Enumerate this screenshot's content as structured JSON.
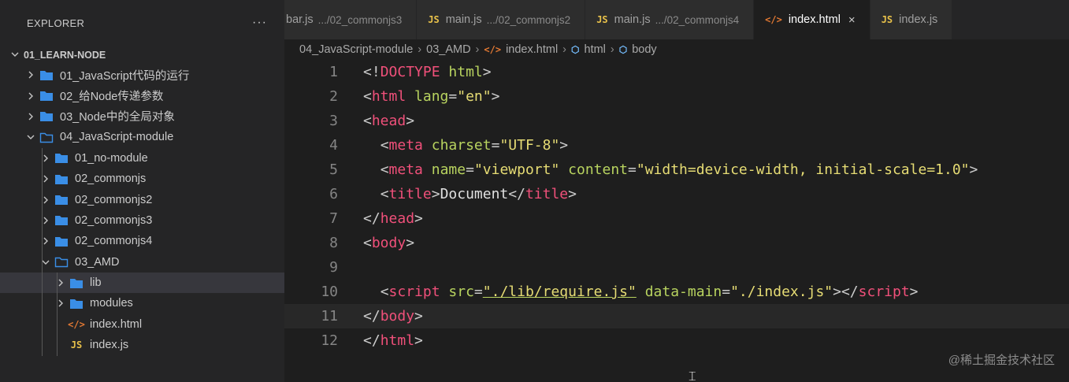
{
  "explorer": {
    "title": "EXPLORER",
    "more": "···",
    "workspace": "01_LEARN-NODE",
    "items": [
      {
        "label": "01_JavaScript代码的运行",
        "type": "folder",
        "depth": 0,
        "open": false
      },
      {
        "label": "02_给Node传递参数",
        "type": "folder",
        "depth": 0,
        "open": false
      },
      {
        "label": "03_Node中的全局对象",
        "type": "folder",
        "depth": 0,
        "open": false
      },
      {
        "label": "04_JavaScript-module",
        "type": "folder",
        "depth": 0,
        "open": true
      },
      {
        "label": "01_no-module",
        "type": "folder",
        "depth": 1,
        "open": false
      },
      {
        "label": "02_commonjs",
        "type": "folder",
        "depth": 1,
        "open": false
      },
      {
        "label": "02_commonjs2",
        "type": "folder",
        "depth": 1,
        "open": false
      },
      {
        "label": "02_commonjs3",
        "type": "folder",
        "depth": 1,
        "open": false
      },
      {
        "label": "02_commonjs4",
        "type": "folder",
        "depth": 1,
        "open": false
      },
      {
        "label": "03_AMD",
        "type": "folder",
        "depth": 1,
        "open": true
      },
      {
        "label": "lib",
        "type": "folder",
        "depth": 2,
        "open": false,
        "active": true
      },
      {
        "label": "modules",
        "type": "folder",
        "depth": 2,
        "open": false
      },
      {
        "label": "index.html",
        "type": "html",
        "depth": 2
      },
      {
        "label": "index.js",
        "type": "js",
        "depth": 2
      }
    ]
  },
  "icons": {
    "js": "JS",
    "html": "</>",
    "close": "×"
  },
  "tabs": [
    {
      "label": "bar.js",
      "desc": ".../02_commonjs3",
      "icon": "none",
      "active": false
    },
    {
      "label": "main.js",
      "desc": ".../02_commonjs2",
      "icon": "js",
      "active": false
    },
    {
      "label": "main.js",
      "desc": ".../02_commonjs4",
      "icon": "js",
      "active": false
    },
    {
      "label": "index.html",
      "desc": "",
      "icon": "html",
      "active": true
    },
    {
      "label": "index.js",
      "desc": "",
      "icon": "js",
      "active": false
    }
  ],
  "breadcrumbs": [
    {
      "label": "04_JavaScript-module",
      "icon": "none"
    },
    {
      "label": "03_AMD",
      "icon": "none"
    },
    {
      "label": "index.html",
      "icon": "html"
    },
    {
      "label": "html",
      "icon": "cube"
    },
    {
      "label": "body",
      "icon": "cube"
    }
  ],
  "editor": {
    "current_line": 11,
    "lines": [
      {
        "n": "1",
        "tokens": [
          [
            "punc",
            "<!"
          ],
          [
            "tag",
            "DOCTYPE"
          ],
          [
            "punc",
            " "
          ],
          [
            "attr",
            "html"
          ],
          [
            "punc",
            ">"
          ]
        ]
      },
      {
        "n": "2",
        "tokens": [
          [
            "punc",
            "<"
          ],
          [
            "tag",
            "html"
          ],
          [
            "punc",
            " "
          ],
          [
            "attr",
            "lang"
          ],
          [
            "punc",
            "="
          ],
          [
            "str",
            "\"en\""
          ],
          [
            "punc",
            ">"
          ]
        ]
      },
      {
        "n": "3",
        "tokens": [
          [
            "punc",
            "<"
          ],
          [
            "tag",
            "head"
          ],
          [
            "punc",
            ">"
          ]
        ]
      },
      {
        "n": "4",
        "tokens": [
          [
            "indent",
            "  "
          ],
          [
            "punc",
            "<"
          ],
          [
            "tag",
            "meta"
          ],
          [
            "punc",
            " "
          ],
          [
            "attr",
            "charset"
          ],
          [
            "punc",
            "="
          ],
          [
            "str",
            "\"UTF-8\""
          ],
          [
            "punc",
            ">"
          ]
        ]
      },
      {
        "n": "5",
        "tokens": [
          [
            "indent",
            "  "
          ],
          [
            "punc",
            "<"
          ],
          [
            "tag",
            "meta"
          ],
          [
            "punc",
            " "
          ],
          [
            "attr",
            "name"
          ],
          [
            "punc",
            "="
          ],
          [
            "str",
            "\"viewport\""
          ],
          [
            "punc",
            " "
          ],
          [
            "attr",
            "content"
          ],
          [
            "punc",
            "="
          ],
          [
            "str",
            "\"width=device-width, initial-scale=1.0\""
          ],
          [
            "punc",
            ">"
          ]
        ]
      },
      {
        "n": "6",
        "tokens": [
          [
            "indent",
            "  "
          ],
          [
            "punc",
            "<"
          ],
          [
            "tag",
            "title"
          ],
          [
            "punc",
            ">"
          ],
          [
            "text",
            "Document"
          ],
          [
            "punc",
            "</"
          ],
          [
            "tag",
            "title"
          ],
          [
            "punc",
            ">"
          ]
        ]
      },
      {
        "n": "7",
        "tokens": [
          [
            "punc",
            "</"
          ],
          [
            "tag",
            "head"
          ],
          [
            "punc",
            ">"
          ]
        ]
      },
      {
        "n": "8",
        "tokens": [
          [
            "punc",
            "<"
          ],
          [
            "tag",
            "body"
          ],
          [
            "punc",
            ">"
          ]
        ]
      },
      {
        "n": "9",
        "tokens": [
          [
            "indent",
            "  "
          ]
        ]
      },
      {
        "n": "10",
        "tokens": [
          [
            "indent",
            "  "
          ],
          [
            "punc",
            "<"
          ],
          [
            "tag",
            "script"
          ],
          [
            "punc",
            " "
          ],
          [
            "attr",
            "src"
          ],
          [
            "punc",
            "="
          ],
          [
            "strlink",
            "\"./lib/require.js\""
          ],
          [
            "punc",
            " "
          ],
          [
            "attr",
            "data-main"
          ],
          [
            "punc",
            "="
          ],
          [
            "str",
            "\"./index.js\""
          ],
          [
            "punc",
            "></"
          ],
          [
            "tag",
            "script"
          ],
          [
            "punc",
            ">"
          ]
        ]
      },
      {
        "n": "11",
        "tokens": [
          [
            "punc",
            "</"
          ],
          [
            "tag",
            "body"
          ],
          [
            "punc",
            ">"
          ]
        ]
      },
      {
        "n": "12",
        "tokens": [
          [
            "punc",
            "</"
          ],
          [
            "tag",
            "html"
          ],
          [
            "punc",
            ">"
          ]
        ]
      }
    ]
  },
  "watermark": "@稀土掘金技术社区"
}
